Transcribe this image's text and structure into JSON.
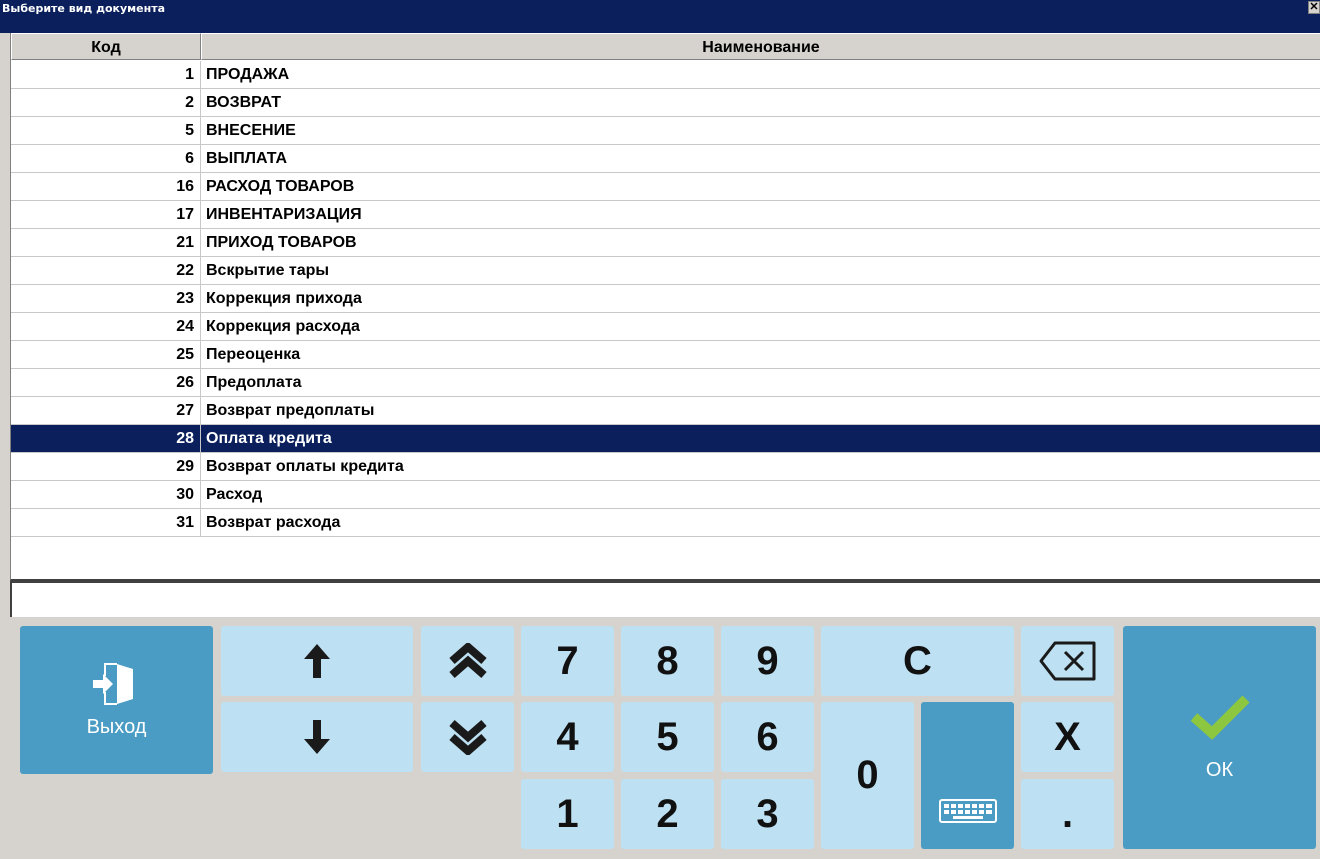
{
  "window": {
    "title": "Выберите вид документа",
    "close_label": "✕"
  },
  "grid": {
    "headers": {
      "code": "Код",
      "name": "Наименование"
    },
    "rows": [
      {
        "code": "1",
        "name": "ПРОДАЖА"
      },
      {
        "code": "2",
        "name": "ВОЗВРАТ"
      },
      {
        "code": "5",
        "name": "ВНЕСЕНИЕ"
      },
      {
        "code": "6",
        "name": "ВЫПЛАТА"
      },
      {
        "code": "16",
        "name": "РАСХОД ТОВАРОВ"
      },
      {
        "code": "17",
        "name": "ИНВЕНТАРИЗАЦИЯ"
      },
      {
        "code": "21",
        "name": "ПРИХОД ТОВАРОВ"
      },
      {
        "code": "22",
        "name": "Вскрытие тары"
      },
      {
        "code": "23",
        "name": "Коррекция прихода"
      },
      {
        "code": "24",
        "name": "Коррекция расхода"
      },
      {
        "code": "25",
        "name": "Переоценка"
      },
      {
        "code": "26",
        "name": "Предоплата"
      },
      {
        "code": "27",
        "name": "Возврат предоплаты"
      },
      {
        "code": "28",
        "name": "Оплата кредита"
      },
      {
        "code": "29",
        "name": "Возврат оплаты кредита"
      },
      {
        "code": "30",
        "name": "Расход"
      },
      {
        "code": "31",
        "name": "Возврат расхода"
      }
    ],
    "selected_code": "28"
  },
  "input": {
    "value": ""
  },
  "keypad": {
    "exit_label": "Выход",
    "ok_label": "ОК",
    "clear_label": "C",
    "multiply_label": "X",
    "dot_label": ".",
    "digits": {
      "d0": "0",
      "d1": "1",
      "d2": "2",
      "d3": "3",
      "d4": "4",
      "d5": "5",
      "d6": "6",
      "d7": "7",
      "d8": "8",
      "d9": "9"
    },
    "icons": {
      "exit": "exit-door-icon",
      "up": "arrow-up-icon",
      "down": "arrow-down-icon",
      "page_up": "double-chevron-up-icon",
      "page_down": "double-chevron-down-icon",
      "backspace": "backspace-icon",
      "keyboard": "keyboard-icon",
      "ok": "checkmark-icon"
    },
    "colors": {
      "key": "#bde0f2",
      "key_dark": "#4a9cc4",
      "ok_check": "#8dc63f",
      "selection": "#0a1f5c"
    }
  }
}
